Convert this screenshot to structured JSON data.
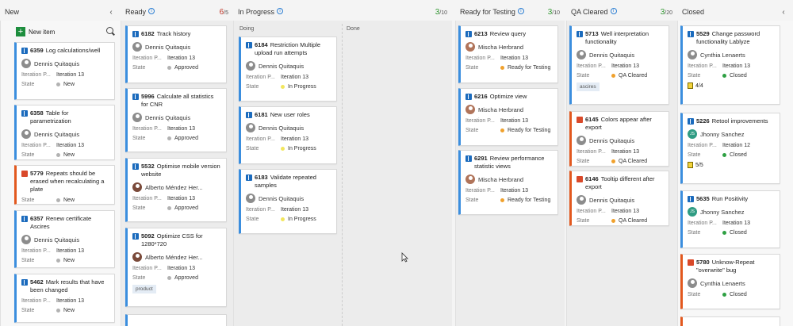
{
  "columns": {
    "new": {
      "title": "New",
      "new_item_label": "New item"
    },
    "ready": {
      "title": "Ready",
      "wip_count": "6",
      "wip_limit": "/5"
    },
    "in_progress": {
      "title": "In Progress",
      "wip_count": "3",
      "wip_limit": "/10",
      "sub_doing": "Doing",
      "sub_done": "Done"
    },
    "ready_for_testing": {
      "title": "Ready for Testing",
      "wip_count": "3",
      "wip_limit": "/10"
    },
    "qa_cleared": {
      "title": "QA Cleared",
      "wip_count": "3",
      "wip_limit": "/20"
    },
    "closed": {
      "title": "Closed"
    }
  },
  "labels": {
    "iteration": "Iteration P...",
    "state": "State"
  },
  "cards": {
    "c6359": {
      "id": "6359",
      "title": "Log calculations/well",
      "assignee": "Dennis Quitaquis",
      "iteration": "Iteration 13",
      "state": "New"
    },
    "c6358": {
      "id": "6358",
      "title": "Table for parametrization",
      "assignee": "Dennis Quitaquis",
      "iteration": "Iteration 13",
      "state": "New"
    },
    "c5779": {
      "id": "5779",
      "title": "Repeats should be erased when recalculating a plate",
      "state": "New"
    },
    "c6357": {
      "id": "6357",
      "title": "Renew certificate Ascires",
      "assignee": "Dennis Quitaquis",
      "iteration": "Iteration 13",
      "state": "New"
    },
    "c5462": {
      "id": "5462",
      "title": "Mark results that have been changed",
      "iteration": "Iteration 13",
      "state": "New"
    },
    "c6182": {
      "id": "6182",
      "title": "Track history",
      "assignee": "Dennis Quitaquis",
      "iteration": "Iteration 13",
      "state": "Approved"
    },
    "c5996": {
      "id": "5996",
      "title": "Calculate all statistics for CNR",
      "assignee": "Dennis Quitaquis",
      "iteration": "Iteration 13",
      "state": "Approved"
    },
    "c5532": {
      "id": "5532",
      "title": "Optimise mobile version website",
      "assignee": "Alberto Méndez Her...",
      "iteration": "Iteration 13",
      "state": "Approved"
    },
    "c5092": {
      "id": "5092",
      "title": "Optimize CSS for 1280*720",
      "assignee": "Alberto Méndez Her...",
      "iteration": "Iteration 13",
      "state": "Approved",
      "tag": "product"
    },
    "c6184": {
      "id": "6184",
      "title": "Restriction Multiple upload run attempts",
      "assignee": "Dennis Quitaquis",
      "iteration": "Iteration 13",
      "state": "In Progress"
    },
    "c6181": {
      "id": "6181",
      "title": "New user roles",
      "assignee": "Dennis Quitaquis",
      "iteration": "Iteration 13",
      "state": "In Progress"
    },
    "c6183": {
      "id": "6183",
      "title": "Validate repeated samples",
      "assignee": "Dennis Quitaquis",
      "iteration": "Iteration 13",
      "state": "In Progress"
    },
    "c6213": {
      "id": "6213",
      "title": "Review query",
      "assignee": "Mischa Herbrand",
      "iteration": "Iteration 13",
      "state": "Ready for Testing"
    },
    "c6216": {
      "id": "6216",
      "title": "Optimize view",
      "assignee": "Mischa Herbrand",
      "iteration": "Iteration 13",
      "state": "Ready for Testing"
    },
    "c6291": {
      "id": "6291",
      "title": "Review performance statistic views",
      "assignee": "Mischa Herbrand",
      "iteration": "Iteration 13",
      "state": "Ready for Testing"
    },
    "c5713": {
      "id": "5713",
      "title": "Well interpretation functionality",
      "assignee": "Dennis Quitaquis",
      "iteration": "Iteration 13",
      "state": "QA Cleared",
      "tag": "ascires"
    },
    "c6145": {
      "id": "6145",
      "title": "Colors appear after export",
      "assignee": "Dennis Quitaquis",
      "iteration": "Iteration 13",
      "state": "QA Cleared"
    },
    "c6146": {
      "id": "6146",
      "title": "Tooltip different after export",
      "assignee": "Dennis Quitaquis",
      "iteration": "Iteration 13",
      "state": "QA Cleared"
    },
    "c5529": {
      "id": "5529",
      "title": "Change password functionality Lablyze",
      "assignee": "Cynthia Lenaerts",
      "iteration": "Iteration 13",
      "state": "Closed",
      "tasks": "4/4"
    },
    "c5226": {
      "id": "5226",
      "title": "Retool improvements",
      "assignee": "Jhonny Sanchez",
      "assignee_initials": "JS",
      "iteration": "Iteration 12",
      "state": "Closed",
      "tasks": "5/5"
    },
    "c5635": {
      "id": "5635",
      "title": "Run Positivity",
      "assignee": "Jhonny Sanchez",
      "assignee_initials": "JS",
      "iteration": "Iteration 13",
      "state": "Closed"
    },
    "c5780": {
      "id": "5780",
      "title": "Unknow-Repeat \"overwrite\" bug",
      "assignee": "Cynthia Lenaerts",
      "state": "Closed"
    }
  },
  "colors": {
    "new": "#b2b2b2",
    "approved": "#b2b2b2",
    "in_progress": "#f2e65e",
    "ready_for_testing": "#f0a12d",
    "qa_cleared": "#f0a12d",
    "closed": "#2ea043"
  }
}
